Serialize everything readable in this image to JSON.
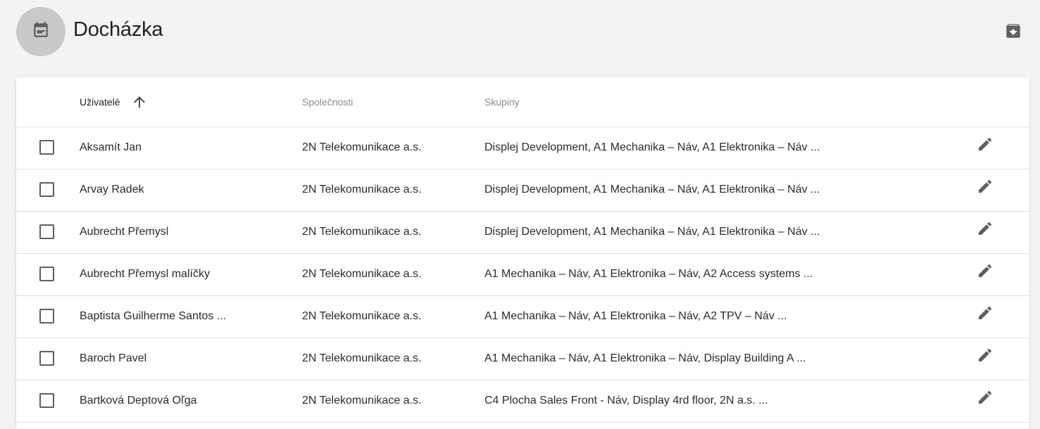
{
  "header": {
    "title": "Docházka",
    "avatar_icon": "calendar-icon",
    "archive_icon": "archive-download-icon"
  },
  "table": {
    "columns": {
      "users": "Uživatelé",
      "companies": "Společnosti",
      "groups": "Skupiny"
    },
    "sort": {
      "column": "users",
      "direction": "ascending",
      "icon": "arrow-up-icon"
    },
    "rows": [
      {
        "user": "Aksamít Jan",
        "company": "2N Telekomunikace a.s.",
        "groups": "Displej Development, A1 Mechanika – Náv, A1 Elektronika – Náv ...",
        "checked": false
      },
      {
        "user": "Arvay Radek",
        "company": "2N Telekomunikace a.s.",
        "groups": "Displej Development, A1 Mechanika – Náv, A1 Elektronika – Náv ...",
        "checked": false
      },
      {
        "user": "Aubrecht Přemysl",
        "company": "2N Telekomunikace a.s.",
        "groups": "Displej Development, A1 Mechanika – Náv, A1 Elektronika – Náv ...",
        "checked": false
      },
      {
        "user": "Aubrecht Přemysl malíčky",
        "company": "2N Telekomunikace a.s.",
        "groups": "A1 Mechanika – Náv, A1 Elektronika – Náv, A2 Access systems ...",
        "checked": false
      },
      {
        "user": "Baptista Guilherme Santos ...",
        "company": "2N Telekomunikace a.s.",
        "groups": "A1 Mechanika – Náv, A1 Elektronika – Náv, A2 TPV – Náv ...",
        "checked": false
      },
      {
        "user": "Baroch Pavel",
        "company": "2N Telekomunikace a.s.",
        "groups": "A1 Mechanika – Náv, A1 Elektronika – Náv, Display Building A ...",
        "checked": false
      },
      {
        "user": "Bartková Deptová Oľga",
        "company": "2N Telekomunikace a.s.",
        "groups": "C4 Plocha Sales Front - Náv, Display 4rd floor, 2N a.s. ...",
        "checked": false
      }
    ],
    "row_action_icon": "pencil-edit-icon"
  }
}
